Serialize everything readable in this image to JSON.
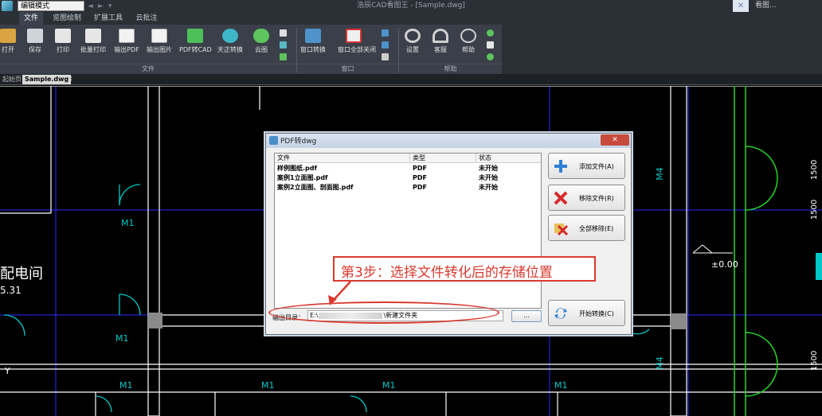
{
  "titlebar": {
    "mode": "编辑模式",
    "title": "浩辰CAD看图王 - [Sample.dwg]",
    "user": "看图..."
  },
  "menu": {
    "tabs": [
      {
        "label": "文件",
        "active": true
      },
      {
        "label": "览图绘制",
        "active": false
      },
      {
        "label": "扩展工具",
        "active": false
      },
      {
        "label": "云批注",
        "active": false
      }
    ]
  },
  "ribbon": {
    "buttons": [
      {
        "label": "打开"
      },
      {
        "label": "保存"
      },
      {
        "label": "打印"
      },
      {
        "label": "批量打印"
      },
      {
        "label": "输出PDF"
      },
      {
        "label": "输出图片"
      },
      {
        "label": "PDF转CAD"
      },
      {
        "label": "天正转换"
      },
      {
        "label": "云图"
      },
      {
        "label": "窗口转换"
      },
      {
        "label": "窗口全部关闭"
      },
      {
        "label": "设置"
      },
      {
        "label": "客服"
      },
      {
        "label": "帮助"
      }
    ],
    "groups": [
      "文件",
      "窗口",
      "帮助"
    ]
  },
  "doctabs": {
    "home": "起始页",
    "active": "Sample.dwg",
    "close": "✕"
  },
  "canvas": {
    "labels": [
      "配电间",
      "5.31",
      "M1",
      "M1",
      "M1",
      "M1",
      "M1",
      "M1",
      "M4",
      "M4",
      "±0.00",
      "1500",
      "1500",
      "1500",
      "Y"
    ]
  },
  "dialog": {
    "title": "PDF转dwg",
    "close": "✕",
    "columns": [
      "文件",
      "类型",
      "状态"
    ],
    "rows": [
      {
        "file": "样例图纸.pdf",
        "type": "PDF",
        "status": "未开始"
      },
      {
        "file": "案例1立面图.pdf",
        "type": "PDF",
        "status": "未开始"
      },
      {
        "file": "案例2立面图、剖面图.pdf",
        "type": "PDF",
        "status": "未开始"
      }
    ],
    "buttons": {
      "add": "添加文件(A)",
      "remove": "移除文件(R)",
      "remove_all": "全部移除(E)",
      "start": "开始转换(C)",
      "browse": "..."
    },
    "output_label": "输出目录：",
    "output_path_start": "E:\\",
    "output_path_end": "\\新建文件夹"
  },
  "annotation": {
    "text": "第3步：选择文件转化后的存储位置"
  },
  "colors": {
    "accent": "#d93a2f",
    "wall": "#ffffff",
    "grid": "#2a2aff",
    "door": "#00c8c8",
    "green": "#22cc22"
  }
}
